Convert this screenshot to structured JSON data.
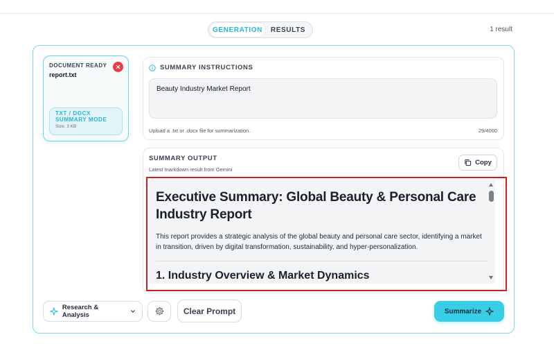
{
  "tabs": [
    {
      "label": "GENERATION",
      "active": true
    },
    {
      "label": "RESULTS",
      "active": false
    }
  ],
  "result_count": "1 result",
  "document": {
    "status": "DOCUMENT READY",
    "filename": "report.txt",
    "mode_label": "TXT / DOCX SUMMARY MODE",
    "size": "Size: 3 KB"
  },
  "instructions": {
    "title": "SUMMARY INSTRUCTIONS",
    "value": "Beauty Industry Market Report",
    "helper": "Upload a .txt or .docx file for summarization.",
    "char_count": "29/4000"
  },
  "output": {
    "title": "SUMMARY OUTPUT",
    "subtitle": "Latest markdown result from Gemini",
    "copy_label": "Copy",
    "heading": "Executive Summary: Global Beauty & Personal Care Industry Report",
    "paragraph": "This report provides a strategic analysis of the global beauty and personal care sector, identifying a market in transition, driven by digital transformation, sustainability, and hyper-personalization.",
    "section_heading": "1. Industry Overview & Market Dynamics"
  },
  "footer": {
    "mode_select": "Research & Analysis",
    "clear_label": "Clear Prompt",
    "summarize_label": "Summarize"
  },
  "colors": {
    "accent": "#22b8d6",
    "accent_button": "#39cde6",
    "danger": "#ef3b47",
    "highlight": "#d11f1f"
  }
}
